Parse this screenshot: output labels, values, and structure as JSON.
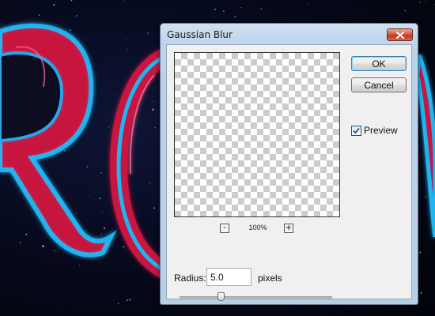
{
  "dialog": {
    "title": "Gaussian Blur",
    "close_icon": "close-x-icon"
  },
  "preview": {
    "zoom_out_label": "-",
    "zoom_in_label": "+",
    "zoom_level": "100%"
  },
  "buttons": {
    "ok_label": "OK",
    "cancel_label": "Cancel"
  },
  "preview_toggle": {
    "label": "Preview",
    "checked": true
  },
  "radius": {
    "label": "Radius:",
    "value": "5.0",
    "units": "pixels",
    "slider_fraction": 0.27
  },
  "background": {
    "description_colors": {
      "space": "#050818",
      "neon_pink": "#e0144c",
      "neon_blue": "#19b7f5"
    }
  }
}
